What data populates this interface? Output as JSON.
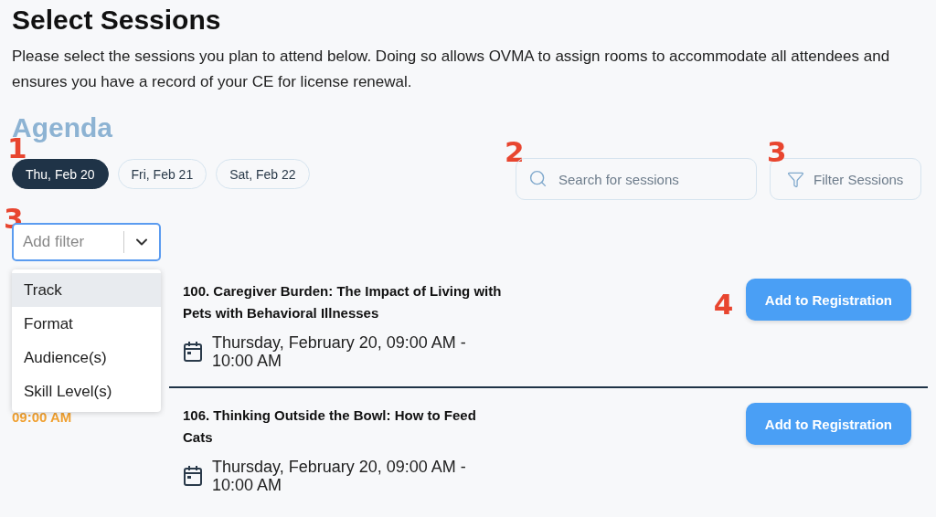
{
  "title": "Select Sessions",
  "intro": "Please select the sessions you plan to attend below. Doing so allows OVMA to assign rooms to accommodate all attendees and ensures you have a record of your CE for license renewal.",
  "agenda_title": "Agenda",
  "days": {
    "annotation": "1",
    "items": [
      {
        "label": "Thu, Feb 20",
        "selected": true
      },
      {
        "label": "Fri, Feb 21",
        "selected": false
      },
      {
        "label": "Sat, Feb 22",
        "selected": false
      }
    ]
  },
  "search": {
    "annotation": "2",
    "placeholder": "Search for sessions"
  },
  "filter_button": {
    "annotation": "3",
    "label": "Filter Sessions"
  },
  "add_filter": {
    "annotation": "3",
    "placeholder": "Add filter",
    "expanded": true,
    "options": [
      {
        "label": "Track",
        "selected": true
      },
      {
        "label": "Format",
        "selected": false
      },
      {
        "label": "Audience(s)",
        "selected": false
      },
      {
        "label": "Skill Level(s)",
        "selected": false
      }
    ]
  },
  "sessions": [
    {
      "title": "100. Caregiver Burden: The Impact of Living with Pets with Behavioral Illnesses",
      "when": "Thursday, February 20, 09:00 AM - 10:00 AM",
      "button": "Add to Registration",
      "annotation": "4"
    },
    {
      "time": "09:00 AM",
      "title": "106. Thinking Outside the Bowl: How to Feed Cats",
      "when": "Thursday, February 20, 09:00 AM - 10:00 AM",
      "button": "Add to Registration"
    }
  ]
}
